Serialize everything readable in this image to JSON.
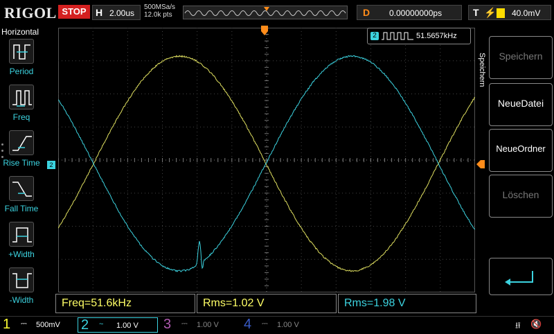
{
  "top": {
    "logo": "RIGOL",
    "run_state": "STOP",
    "h_label": "H",
    "timebase": "2.00us",
    "sample_rate": "500MSa/s",
    "memory_depth": "12.0k pts",
    "delay_label": "D",
    "delay_value": "0.00000000ps",
    "trigger_label": "T",
    "trigger_level": "40.0mV"
  },
  "left_menu": {
    "title": "Horizontal",
    "items": [
      {
        "label": "Period",
        "icon": "period-icon"
      },
      {
        "label": "Freq",
        "icon": "freq-icon"
      },
      {
        "label": "Rise Time",
        "icon": "rise-time-icon"
      },
      {
        "label": "Fall Time",
        "icon": "fall-time-icon"
      },
      {
        "label": "+Width",
        "icon": "pos-width-icon"
      },
      {
        "label": "-Width",
        "icon": "neg-width-icon"
      }
    ]
  },
  "screen": {
    "freq_counter_ch": "2",
    "freq_counter_value": "51.5657kHz",
    "ch2_marker": "2",
    "colors": {
      "ch1": "#e0e060",
      "ch2": "#3cd3e0",
      "trigger": "#ff8c1a"
    }
  },
  "measurements": [
    {
      "text": "Freq=51.6kHz"
    },
    {
      "text": "Rms=1.02 V"
    },
    {
      "text": "Rms=1.98 V"
    }
  ],
  "right_menu": {
    "title": "Speichern",
    "buttons": [
      {
        "label": "Speichern",
        "enabled": false
      },
      {
        "label": "NeueDatei",
        "enabled": true
      },
      {
        "label": "NeueOrdner",
        "enabled": true
      },
      {
        "label": "Löschen",
        "enabled": false
      }
    ]
  },
  "channels": [
    {
      "num": "1",
      "coupling": "⎓",
      "scale": "500mV"
    },
    {
      "num": "2",
      "coupling": "~",
      "scale": "1.00 V"
    },
    {
      "num": "3",
      "coupling": "⎓",
      "scale": "1.00 V"
    },
    {
      "num": "4",
      "coupling": "⎓",
      "scale": "1.00 V"
    }
  ]
}
